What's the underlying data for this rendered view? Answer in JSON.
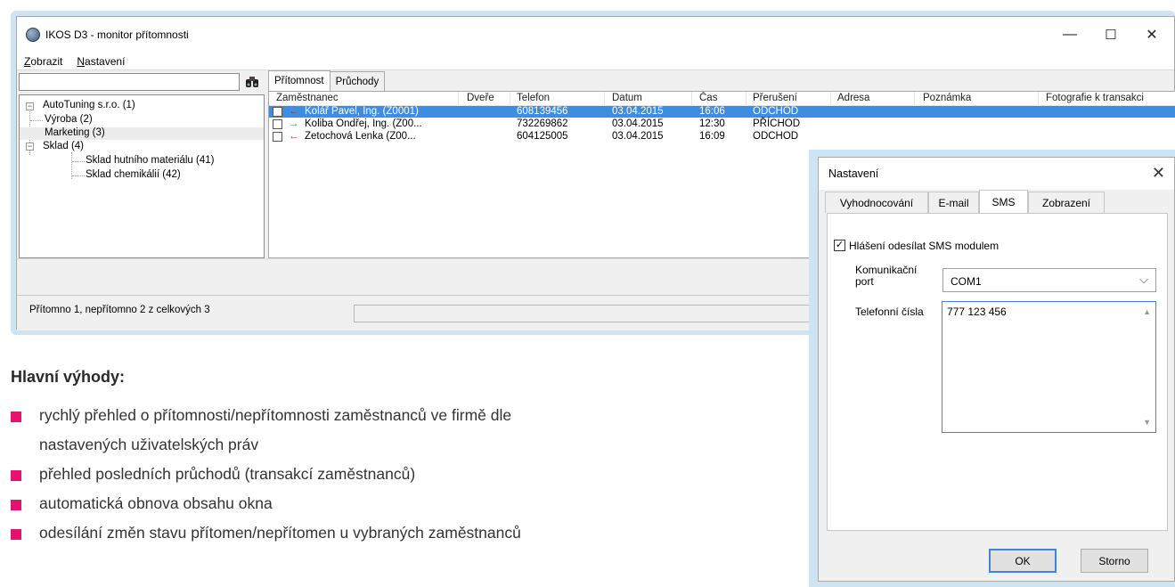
{
  "window": {
    "title": "IKOS D3 - monitor přítomnosti",
    "controls": {
      "minimize": "—",
      "maximize": "☐",
      "close": "✕"
    }
  },
  "menu": [
    {
      "label": "Zobrazit",
      "underline": "Z",
      "rest": "obrazit"
    },
    {
      "label": "Nastavení",
      "underline": "N",
      "rest": "astavení"
    }
  ],
  "search": {
    "value": ""
  },
  "tree": {
    "root": "AutoTuning s.r.o. (1)",
    "items": [
      "Výroba (2)",
      "Marketing (3)",
      "Sklad (4)",
      "Sklad hutního materiálu (41)",
      "Sklad chemikálií (42)"
    ]
  },
  "tabs": [
    "Přítomnost",
    "Průchody"
  ],
  "table": {
    "columns": [
      "Zaměstnanec",
      "Dveře",
      "Telefon",
      "Datum",
      "Čas",
      "Přerušení",
      "Adresa",
      "Poznámka",
      "Fotografie k transakci"
    ],
    "rows": [
      {
        "name": "Kolář Pavel, Ing. (Z0001)",
        "dvere": "",
        "telefon": "608139456",
        "datum": "03.04.2015",
        "cas": "16:06",
        "preruseni": "ODCHOD",
        "arrow": "←",
        "arrow_color": "#d8261f",
        "selected": true
      },
      {
        "name": "Koliba Ondřej, Ing. (Z00...",
        "dvere": "",
        "telefon": "732269862",
        "datum": "03.04.2015",
        "cas": "12:30",
        "preruseni": "PŘÍCHOD",
        "arrow": "→",
        "arrow_color": "#2aa12a",
        "selected": false
      },
      {
        "name": "Zetochová Lenka (Z00...",
        "dvere": "",
        "telefon": "604125005",
        "datum": "03.04.2015",
        "cas": "16:09",
        "preruseni": "ODCHOD",
        "arrow": "←",
        "arrow_color": "#d8261f",
        "selected": false
      }
    ]
  },
  "status": {
    "text": "Přítomno 1, nepřítomno 2 z celkových 3"
  },
  "doc": {
    "heading": "Hlavní výhody:",
    "bullets": [
      "rychlý přehled o přítomnosti/nepřítomnosti zaměstnanců ve firmě dle",
      "nastavených uživatelských práv",
      "přehled posledních průchodů (transakcí zaměstnanců)",
      "automatická obnova obsahu okna",
      "odesílání změn stavu přítomen/nepřítomen u vybraných zaměstnanců"
    ],
    "bullet_color": "#e5136f"
  },
  "dialog": {
    "title": "Nastavení",
    "close": "✕",
    "tabs": [
      "Vyhodnocování",
      "E-mail",
      "SMS",
      "Zobrazení"
    ],
    "active_tab": "SMS",
    "checkbox": {
      "label": "Hlášení odesílat SMS modulem",
      "checked": true
    },
    "port_label_1": "Komunikační",
    "port_label_2": "port",
    "port_value": "COM1",
    "phones_label": "Telefonní čísla",
    "phones_value": "777 123 456",
    "ok": "OK",
    "cancel": "Storno"
  },
  "colors": {
    "selection": "#3d8ee3",
    "frame": "#cde4f3",
    "focus": "#3f86d4"
  }
}
